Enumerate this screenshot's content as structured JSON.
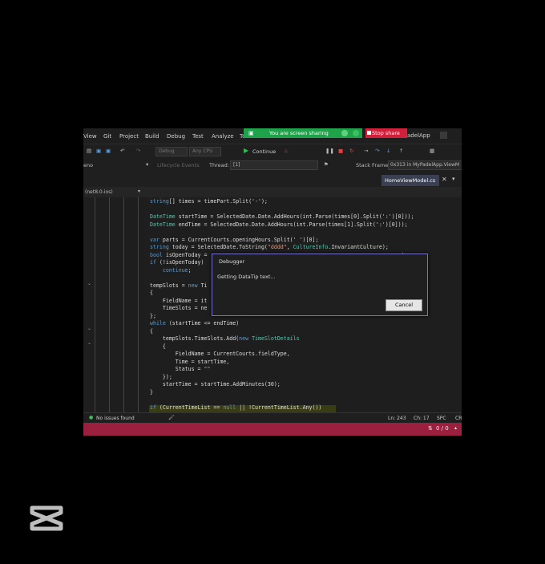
{
  "menu": [
    "View",
    "Git",
    "Project",
    "Build",
    "Debug",
    "Test",
    "Analyze",
    "To"
  ],
  "share_banner": {
    "text": "You are screen sharing",
    "stop": "Stop share"
  },
  "app_name": "adelApp",
  "toolbar": {
    "config": "Debug",
    "platform": "Any CPU",
    "continue_label": "Continue"
  },
  "locbar": {
    "process": "eno",
    "lifecycle": "Lifecycle Events",
    "thread_label": "Thread:",
    "thread_value": "[1]",
    "stack_label": "Stack Frame:",
    "stack_value": "0x313 in MyPadelApp.ViewM"
  },
  "tab": {
    "filename": "HomeViewModel.cs"
  },
  "nav": {
    "target": "(net8.0-ios)"
  },
  "code_lines": [
    "string[] times = timePart.Split('-');",
    "",
    "DateTime startTime = SelectedDate.Date.AddHours(int.Parse(times[0].Split(':')[0]));",
    "DateTime endTime = SelectedDate.Date.AddHours(int.Parse(times[1].Split(':')[0]));",
    "",
    "var parts = CurrentCourts.openingHours.Split(' ')[0];",
    "string today = SelectedDate.ToString(\"dddd\", CultureInfo.InvariantCulture);",
    "bool isOpenToday =                                                          ase);",
    "if (!isOpenToday)",
    "    continue;",
    "",
    "tempSlots = new Ti",
    "{",
    "    FieldName = it",
    "    TimeSlots = ne",
    "};",
    "while (startTime <= endTime)",
    "{",
    "    tempSlots.TimeSlots.Add(new TimeSlotDetails",
    "    {",
    "        FieldName = CurrentCourts.fieldType,",
    "        Time = startTime,",
    "        Status = \"\"",
    "    });",
    "    startTime = startTime.AddMinutes(30);",
    "}",
    "",
    "if (CurrentTimeList == null || !CurrentTimeList.Any())"
  ],
  "dialog": {
    "title": "Debugger",
    "message": "Getting DataTip text...",
    "cancel": "Cancel"
  },
  "status": {
    "issues": "No issues found",
    "line": "Ln: 243",
    "col": "Ch: 17",
    "mode": "SPC",
    "enc": "CR"
  },
  "bottom": {
    "counter": "0 / 0"
  },
  "colors": {
    "share": "#1fa34a",
    "stop": "#d21f3a",
    "bottom_bar": "#9b1f3f",
    "dialog_border": "#7773c5"
  }
}
